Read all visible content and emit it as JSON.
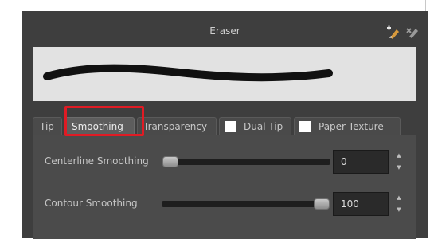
{
  "panel": {
    "title": "Eraser",
    "icons": [
      "create-preset-icon",
      "delete-preset-icon"
    ]
  },
  "tabs": [
    {
      "label": "Tip",
      "active": false
    },
    {
      "label": "Smoothing",
      "active": true
    },
    {
      "label": "Transparency",
      "active": false
    },
    {
      "label": "Dual Tip",
      "active": false,
      "checkbox": true
    },
    {
      "label": "Paper Texture",
      "active": false,
      "checkbox": true
    }
  ],
  "smoothing": {
    "centerline": {
      "label": "Centerline Smoothing",
      "value": "0",
      "slider_fraction": 0
    },
    "contour": {
      "label": "Contour Smoothing",
      "value": "100",
      "slider_fraction": 1
    }
  },
  "colors": {
    "highlight": "#e01b24",
    "panel": "#3e3e3e"
  }
}
